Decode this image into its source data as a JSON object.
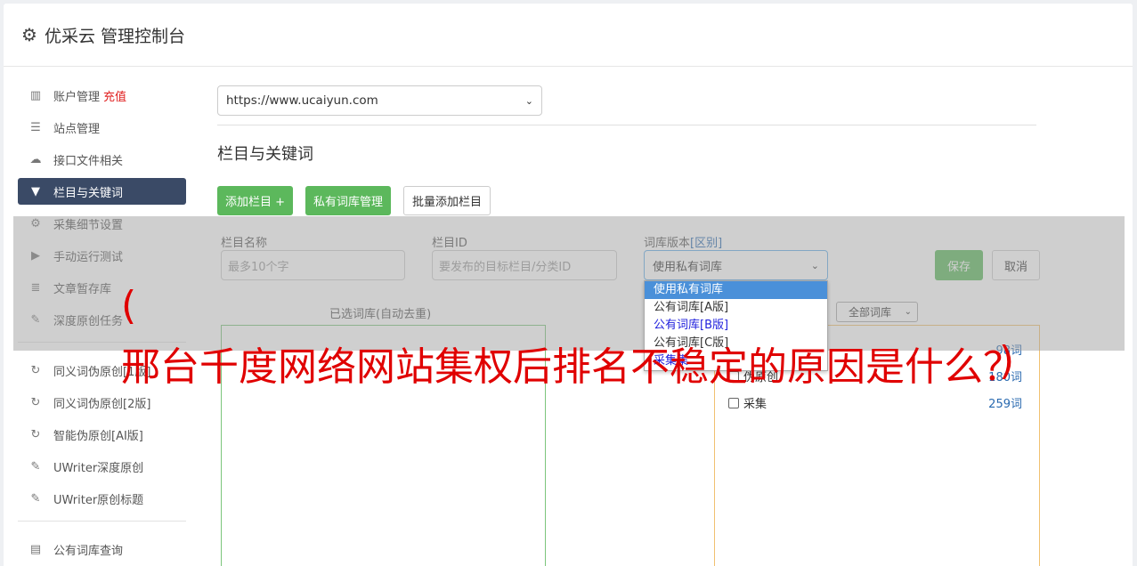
{
  "header": {
    "title": "优采云 管理控制台",
    "icon": "gear-icon"
  },
  "sidebar": {
    "items": [
      {
        "label": "账户管理",
        "badge": "充值",
        "icon": "bar-chart-icon"
      },
      {
        "label": "站点管理",
        "icon": "server-icon"
      },
      {
        "label": "接口文件相关",
        "icon": "cloud-upload-icon"
      },
      {
        "label": "栏目与关键词",
        "icon": "filter-icon",
        "active": true
      },
      {
        "label": "采集细节设置",
        "icon": "cogs-icon"
      },
      {
        "label": "手动运行测试",
        "icon": "play-circle-icon"
      },
      {
        "label": "文章暂存库",
        "icon": "database-icon"
      },
      {
        "label": "深度原创任务",
        "icon": "edit-icon"
      }
    ],
    "items2": [
      {
        "label": "同义词伪原创[1版]",
        "icon": "refresh-icon"
      },
      {
        "label": "同义词伪原创[2版]",
        "icon": "refresh-icon"
      },
      {
        "label": "智能伪原创[AI版]",
        "icon": "refresh-icon"
      },
      {
        "label": "UWriter深度原创",
        "icon": "edit-icon"
      },
      {
        "label": "UWriter原创标题",
        "icon": "edit-icon"
      }
    ],
    "items3": [
      {
        "label": "公有词库查询",
        "icon": "book-icon"
      }
    ]
  },
  "main": {
    "site_select": "https://www.ucaiyun.com",
    "section_title": "栏目与关键词",
    "buttons": {
      "add": "添加栏目 +",
      "private_lib": "私有词库管理",
      "batch_add": "批量添加栏目"
    },
    "form": {
      "name_label": "栏目名称",
      "name_placeholder": "最多10个字",
      "id_label": "栏目ID",
      "id_placeholder": "要发布的目标栏目/分类ID",
      "version_label": "词库版本",
      "version_link": "[区别]",
      "version_value": "使用私有词库",
      "save": "保存",
      "cancel": "取消"
    },
    "dropdown_options": [
      "使用私有词库",
      "公有词库[A版]",
      "公有词库[B版]",
      "公有词库[C版]",
      "采集集"
    ],
    "selected_label": "已选词库(自动去重)",
    "lib_filter": "全部词库",
    "libraries": [
      {
        "name": "伪原创",
        "count": "180词"
      },
      {
        "name": "采集",
        "count": "259词"
      }
    ],
    "partial_count": "98词"
  },
  "overlay_text": {
    "open_paren": "(",
    "headline": "邢台千度网络网站集权后排名不稳定的原因是什么？",
    "close_paren": ")"
  }
}
